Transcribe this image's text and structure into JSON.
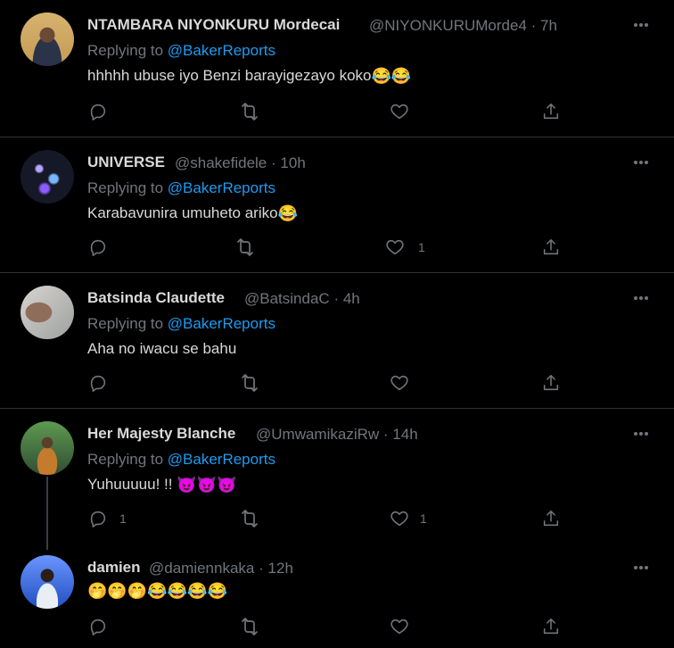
{
  "tweets": [
    {
      "name": "NTAMBARA NIYONKURU Mordecai",
      "handle": "@NIYONKURUMorde4",
      "separator": "·",
      "time": "7h",
      "replying_prefix": "Replying to ",
      "replying_handle": "@BakerReports",
      "text": "hhhhh ubuse iyo Benzi barayigezayo koko",
      "emoji": "😂😂",
      "reply_count": "",
      "like_count": ""
    },
    {
      "name": "UNIVERSE",
      "handle": "@shakefidele",
      "separator": "·",
      "time": "10h",
      "replying_prefix": "Replying to ",
      "replying_handle": "@BakerReports",
      "text": "Karabavunira umuheto ariko",
      "emoji": "😂",
      "reply_count": "",
      "like_count": "1"
    },
    {
      "name": "Batsinda Claudette",
      "handle": "@BatsindaC",
      "separator": "·",
      "time": "4h",
      "replying_prefix": "Replying to ",
      "replying_handle": "@BakerReports",
      "text": "Aha no iwacu se bahu",
      "emoji": "",
      "reply_count": "",
      "like_count": ""
    },
    {
      "name": "Her Majesty Blanche",
      "handle": "@UmwamikaziRw",
      "separator": "·",
      "time": "14h",
      "replying_prefix": "Replying to ",
      "replying_handle": "@BakerReports",
      "text": "Yuhuuuuu! !! ",
      "emoji": "😈😈😈",
      "reply_count": "1",
      "like_count": "1"
    },
    {
      "name": "damien",
      "handle": "@damiennkaka",
      "separator": "·",
      "time": "12h",
      "replying_prefix": "",
      "replying_handle": "",
      "text": "",
      "emoji": "🤭🤭🤭😂😂😂😂",
      "reply_count": "",
      "like_count": ""
    }
  ],
  "icons": {
    "more": "more-icon",
    "reply": "reply-icon",
    "retweet": "retweet-icon",
    "like": "like-icon",
    "share": "share-icon"
  },
  "colors": {
    "background": "#000000",
    "primary_text": "#d9d9d9",
    "secondary_text": "#71767b",
    "link": "#1d9bf0",
    "divider": "#2f3336"
  }
}
